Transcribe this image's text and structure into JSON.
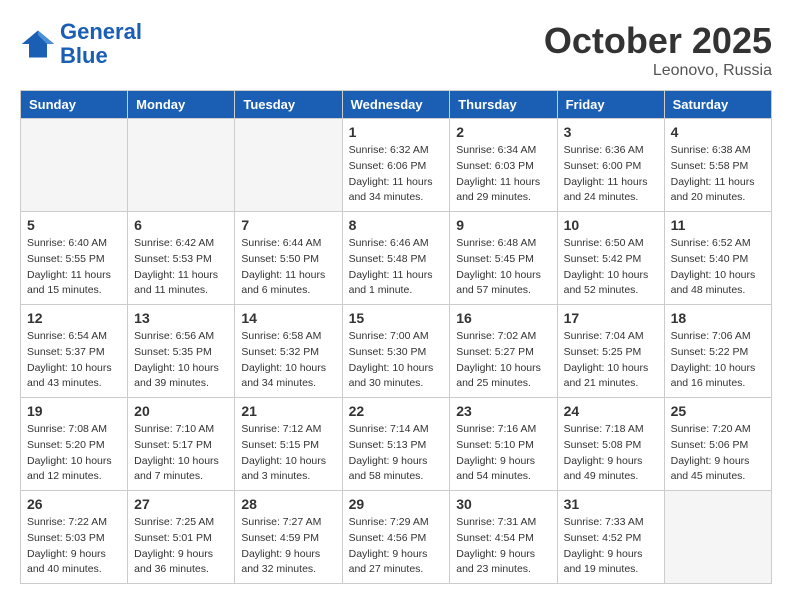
{
  "logo": {
    "line1": "General",
    "line2": "Blue"
  },
  "month": "October 2025",
  "location": "Leonovo, Russia",
  "days_header": [
    "Sunday",
    "Monday",
    "Tuesday",
    "Wednesday",
    "Thursday",
    "Friday",
    "Saturday"
  ],
  "weeks": [
    [
      {
        "num": "",
        "info": ""
      },
      {
        "num": "",
        "info": ""
      },
      {
        "num": "",
        "info": ""
      },
      {
        "num": "1",
        "info": "Sunrise: 6:32 AM\nSunset: 6:06 PM\nDaylight: 11 hours\nand 34 minutes."
      },
      {
        "num": "2",
        "info": "Sunrise: 6:34 AM\nSunset: 6:03 PM\nDaylight: 11 hours\nand 29 minutes."
      },
      {
        "num": "3",
        "info": "Sunrise: 6:36 AM\nSunset: 6:00 PM\nDaylight: 11 hours\nand 24 minutes."
      },
      {
        "num": "4",
        "info": "Sunrise: 6:38 AM\nSunset: 5:58 PM\nDaylight: 11 hours\nand 20 minutes."
      }
    ],
    [
      {
        "num": "5",
        "info": "Sunrise: 6:40 AM\nSunset: 5:55 PM\nDaylight: 11 hours\nand 15 minutes."
      },
      {
        "num": "6",
        "info": "Sunrise: 6:42 AM\nSunset: 5:53 PM\nDaylight: 11 hours\nand 11 minutes."
      },
      {
        "num": "7",
        "info": "Sunrise: 6:44 AM\nSunset: 5:50 PM\nDaylight: 11 hours\nand 6 minutes."
      },
      {
        "num": "8",
        "info": "Sunrise: 6:46 AM\nSunset: 5:48 PM\nDaylight: 11 hours\nand 1 minute."
      },
      {
        "num": "9",
        "info": "Sunrise: 6:48 AM\nSunset: 5:45 PM\nDaylight: 10 hours\nand 57 minutes."
      },
      {
        "num": "10",
        "info": "Sunrise: 6:50 AM\nSunset: 5:42 PM\nDaylight: 10 hours\nand 52 minutes."
      },
      {
        "num": "11",
        "info": "Sunrise: 6:52 AM\nSunset: 5:40 PM\nDaylight: 10 hours\nand 48 minutes."
      }
    ],
    [
      {
        "num": "12",
        "info": "Sunrise: 6:54 AM\nSunset: 5:37 PM\nDaylight: 10 hours\nand 43 minutes."
      },
      {
        "num": "13",
        "info": "Sunrise: 6:56 AM\nSunset: 5:35 PM\nDaylight: 10 hours\nand 39 minutes."
      },
      {
        "num": "14",
        "info": "Sunrise: 6:58 AM\nSunset: 5:32 PM\nDaylight: 10 hours\nand 34 minutes."
      },
      {
        "num": "15",
        "info": "Sunrise: 7:00 AM\nSunset: 5:30 PM\nDaylight: 10 hours\nand 30 minutes."
      },
      {
        "num": "16",
        "info": "Sunrise: 7:02 AM\nSunset: 5:27 PM\nDaylight: 10 hours\nand 25 minutes."
      },
      {
        "num": "17",
        "info": "Sunrise: 7:04 AM\nSunset: 5:25 PM\nDaylight: 10 hours\nand 21 minutes."
      },
      {
        "num": "18",
        "info": "Sunrise: 7:06 AM\nSunset: 5:22 PM\nDaylight: 10 hours\nand 16 minutes."
      }
    ],
    [
      {
        "num": "19",
        "info": "Sunrise: 7:08 AM\nSunset: 5:20 PM\nDaylight: 10 hours\nand 12 minutes."
      },
      {
        "num": "20",
        "info": "Sunrise: 7:10 AM\nSunset: 5:17 PM\nDaylight: 10 hours\nand 7 minutes."
      },
      {
        "num": "21",
        "info": "Sunrise: 7:12 AM\nSunset: 5:15 PM\nDaylight: 10 hours\nand 3 minutes."
      },
      {
        "num": "22",
        "info": "Sunrise: 7:14 AM\nSunset: 5:13 PM\nDaylight: 9 hours\nand 58 minutes."
      },
      {
        "num": "23",
        "info": "Sunrise: 7:16 AM\nSunset: 5:10 PM\nDaylight: 9 hours\nand 54 minutes."
      },
      {
        "num": "24",
        "info": "Sunrise: 7:18 AM\nSunset: 5:08 PM\nDaylight: 9 hours\nand 49 minutes."
      },
      {
        "num": "25",
        "info": "Sunrise: 7:20 AM\nSunset: 5:06 PM\nDaylight: 9 hours\nand 45 minutes."
      }
    ],
    [
      {
        "num": "26",
        "info": "Sunrise: 7:22 AM\nSunset: 5:03 PM\nDaylight: 9 hours\nand 40 minutes."
      },
      {
        "num": "27",
        "info": "Sunrise: 7:25 AM\nSunset: 5:01 PM\nDaylight: 9 hours\nand 36 minutes."
      },
      {
        "num": "28",
        "info": "Sunrise: 7:27 AM\nSunset: 4:59 PM\nDaylight: 9 hours\nand 32 minutes."
      },
      {
        "num": "29",
        "info": "Sunrise: 7:29 AM\nSunset: 4:56 PM\nDaylight: 9 hours\nand 27 minutes."
      },
      {
        "num": "30",
        "info": "Sunrise: 7:31 AM\nSunset: 4:54 PM\nDaylight: 9 hours\nand 23 minutes."
      },
      {
        "num": "31",
        "info": "Sunrise: 7:33 AM\nSunset: 4:52 PM\nDaylight: 9 hours\nand 19 minutes."
      },
      {
        "num": "",
        "info": ""
      }
    ]
  ]
}
